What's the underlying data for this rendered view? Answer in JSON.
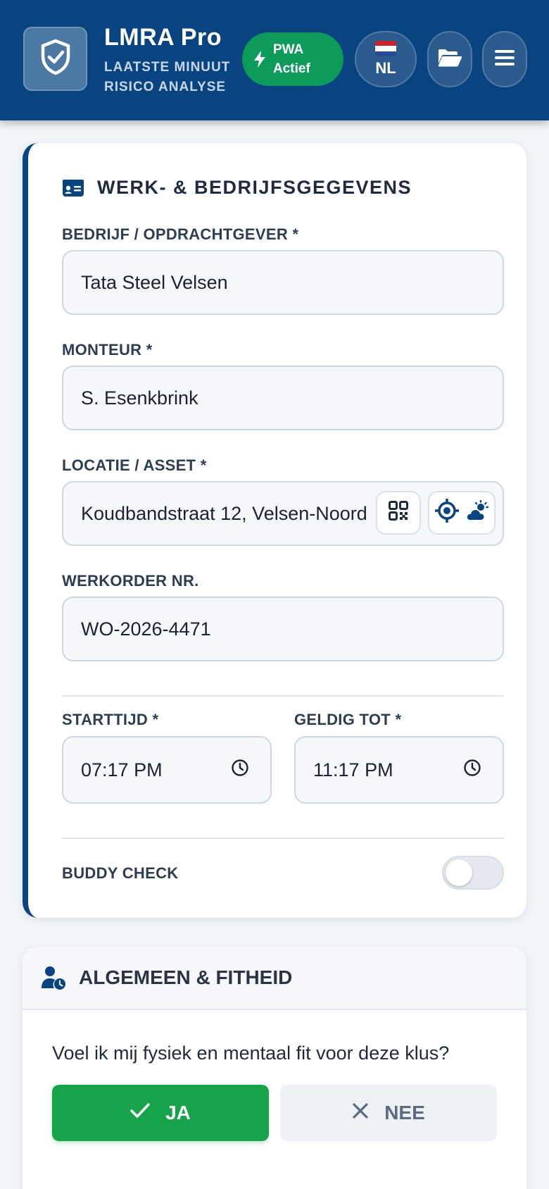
{
  "header": {
    "title": "LMRA Pro",
    "subtitle_line1": "LAATSTE MINUUT",
    "subtitle_line2": "RISICO ANALYSE",
    "pwa_line1": "PWA",
    "pwa_line2": "Actief",
    "language": "NL",
    "colors": {
      "bar": "#0a4480",
      "pwa": "#0d9b5c"
    }
  },
  "work_section": {
    "title": "WERK- & BEDRIJFSGEGEVENS",
    "company_label": "BEDRIJF / OPDRACHTGEVER *",
    "company_value": "Tata Steel Velsen",
    "mechanic_label": "MONTEUR *",
    "mechanic_value": "S. Esenkbrink",
    "location_label": "LOCATIE / ASSET *",
    "location_value": "Koudbandstraat 12, Velsen-Noord",
    "workorder_label": "WERKORDER NR.",
    "workorder_value": "WO-2026-4471",
    "start_label": "STARTTIJD *",
    "start_value": "07:17 PM",
    "valid_label": "GELDIG TOT *",
    "valid_value": "11:17 PM",
    "buddy_label": "BUDDY CHECK",
    "buddy_enabled": false
  },
  "fitness_section": {
    "title": "ALGEMEEN & FITHEID",
    "question": "Voel ik mij fysiek en mentaal fit voor deze klus?",
    "yes_label": "JA",
    "no_label": "NEE",
    "colors": {
      "yes": "#16a34a"
    }
  },
  "icons": [
    "shield-check-icon",
    "bolt-icon",
    "flag-nl-icon",
    "folder-open-icon",
    "hamburger-menu-icon",
    "id-card-icon",
    "qr-code-icon",
    "crosshair-icon",
    "cloud-sun-icon",
    "clock-icon",
    "user-clock-icon",
    "check-icon",
    "x-icon"
  ]
}
